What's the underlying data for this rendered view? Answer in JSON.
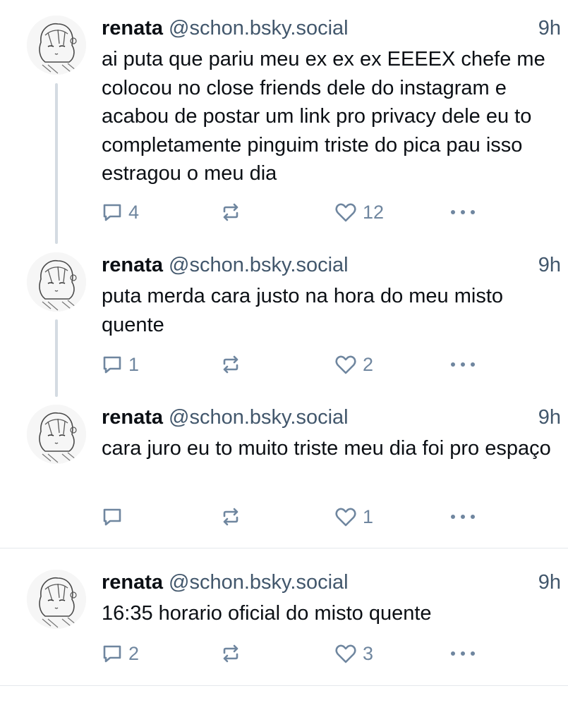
{
  "posts": [
    {
      "name": "renata",
      "handle": "@schon.bsky.social",
      "time": "9h",
      "text": "ai puta que pariu meu ex ex ex EEEEX chefe me colocou no close friends dele do instagram e acabou de postar um link pro privacy dele eu to completamente pinguim triste do pica pau isso estragou o meu dia",
      "replies": "4",
      "reposts": "",
      "likes": "12"
    },
    {
      "name": "renata",
      "handle": "@schon.bsky.social",
      "time": "9h",
      "text": "puta merda cara justo na hora do meu misto quente",
      "replies": "1",
      "reposts": "",
      "likes": "2"
    },
    {
      "name": "renata",
      "handle": "@schon.bsky.social",
      "time": "9h",
      "text": "cara juro eu to muito triste meu dia foi pro espaço",
      "replies": "",
      "reposts": "",
      "likes": "1"
    },
    {
      "name": "renata",
      "handle": "@schon.bsky.social",
      "time": "9h",
      "text": "16:35 horario oficial do misto quente",
      "replies": "2",
      "reposts": "",
      "likes": "3"
    }
  ],
  "icons": {
    "reply": "speech-bubble-icon",
    "repost": "repost-arrows-icon",
    "like": "heart-icon",
    "more": "ellipsis-icon"
  },
  "colors": {
    "text": "#0b0f14",
    "secondary": "#42576c",
    "action": "#6f869f",
    "thread_line": "#d4dbe2",
    "divider": "#e4e8ec",
    "background": "#ffffff"
  }
}
